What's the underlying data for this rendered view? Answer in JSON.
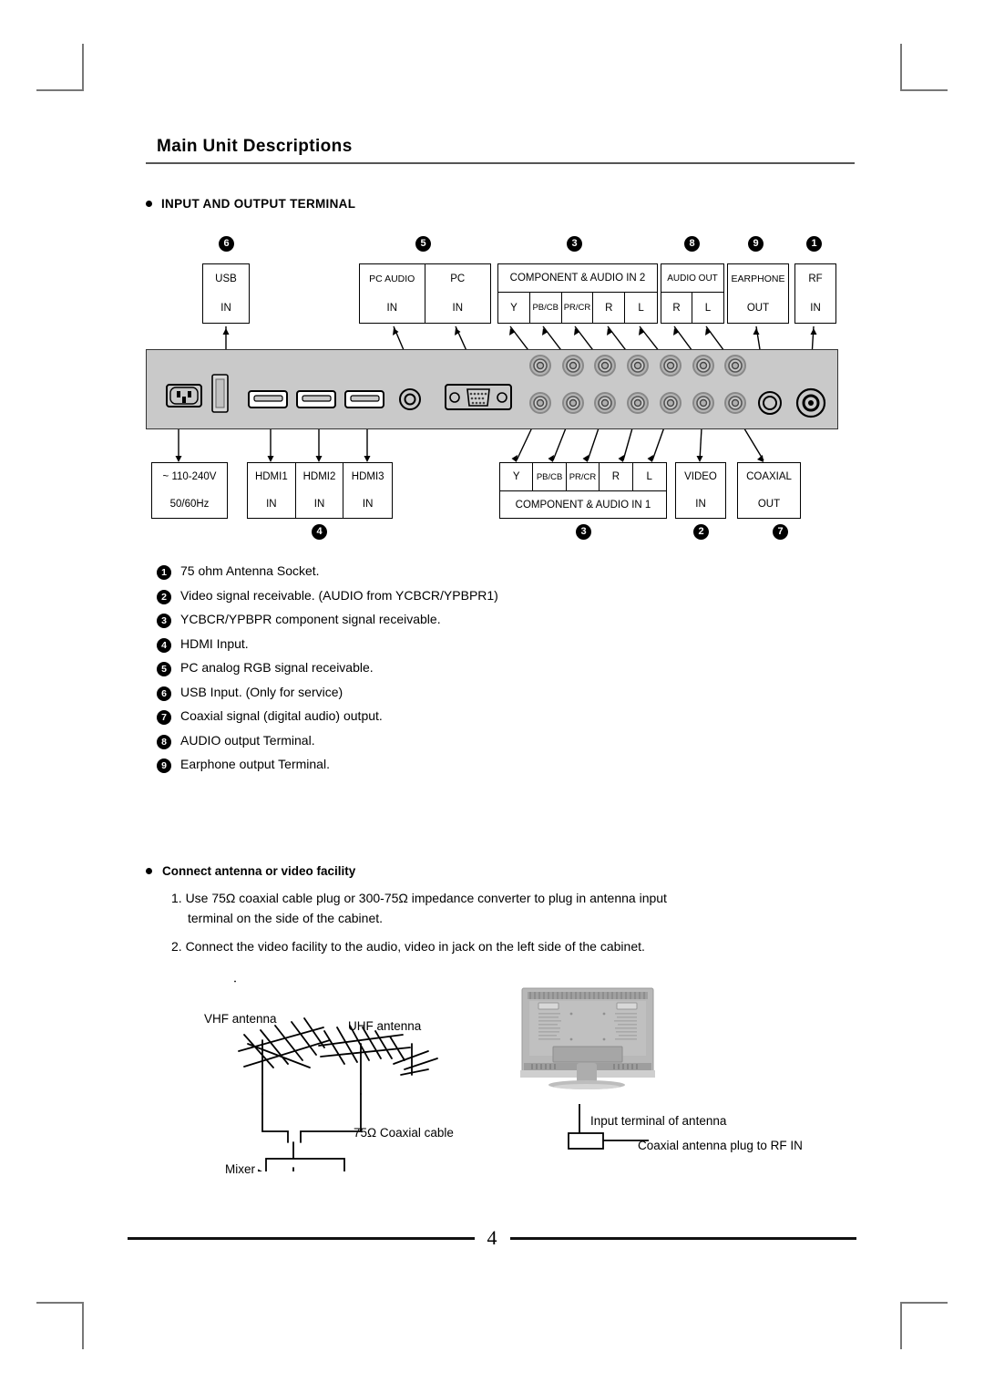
{
  "header": {
    "title": "Main Unit Descriptions"
  },
  "section": {
    "heading": "INPUT AND OUTPUT TERMINAL"
  },
  "diagram": {
    "top_labels": {
      "usb": {
        "line1": "USB",
        "line2": "IN",
        "marker": "6"
      },
      "pc_audio": {
        "line1": "PC AUDIO",
        "line2": "IN"
      },
      "pc": {
        "line1": "PC",
        "line2": "IN",
        "marker": "5"
      },
      "component2": {
        "title": "COMPONENT & AUDIO IN 2",
        "cells": [
          "Y",
          "PB/CB",
          "PR/CR",
          "R",
          "L"
        ],
        "marker": "3"
      },
      "audio_out": {
        "title": "AUDIO OUT",
        "cells": [
          "R",
          "L"
        ],
        "marker": "8"
      },
      "earphone": {
        "line1": "EARPHONE",
        "line2": "OUT",
        "marker": "9"
      },
      "rf": {
        "line1": "RF",
        "line2": "IN",
        "marker": "1"
      }
    },
    "bottom_labels": {
      "power": {
        "line1": "~ 110-240V",
        "line2": "50/60Hz"
      },
      "hdmi": {
        "cells": [
          "HDMI1",
          "HDMI2",
          "HDMI3"
        ],
        "sub": "IN",
        "marker": "4"
      },
      "component1": {
        "cells": [
          "Y",
          "PB/CB",
          "PR/CR",
          "R",
          "L"
        ],
        "title": "COMPONENT & AUDIO IN 1",
        "marker": "3"
      },
      "video": {
        "line1": "VIDEO",
        "line2": "IN",
        "marker": "2"
      },
      "coaxial": {
        "line1": "COAXIAL",
        "line2": "OUT",
        "marker": "7"
      }
    }
  },
  "legend": [
    {
      "num": "1",
      "text": "75 ohm Antenna Socket."
    },
    {
      "num": "2",
      "text": "Video signal receivable. (AUDIO from YCBCR/YPBPR1)"
    },
    {
      "num": "3",
      "text": "YCBCR/YPBPR  component signal receivable."
    },
    {
      "num": "4",
      "text": "HDMI Input."
    },
    {
      "num": "5",
      "text": "PC analog RGB signal receivable."
    },
    {
      "num": "6",
      "text": "USB Input. (Only for service)"
    },
    {
      "num": "7",
      "text": "Coaxial signal (digital audio) output."
    },
    {
      "num": "8",
      "text": "AUDIO output Terminal."
    },
    {
      "num": "9",
      "text": "Earphone output Terminal."
    }
  ],
  "connect": {
    "heading": "Connect antenna or video facility",
    "step1_line1": "1. Use 75Ω  coaxial cable plug or 300-75Ω  impedance converter to plug in antenna input",
    "step1_line2": "terminal on the side of the cabinet.",
    "step2": "2. Connect the video facility to the audio, video in jack on the left side of the cabinet."
  },
  "figure": {
    "vhf": "VHF antenna",
    "uhf": "UHF antenna",
    "mixer": "Mixer",
    "coax": "75Ω Coaxial cable",
    "input_terminal": "Input terminal of antenna",
    "plug": "Coaxial antenna plug to RF IN"
  },
  "footer": {
    "page": "4"
  }
}
